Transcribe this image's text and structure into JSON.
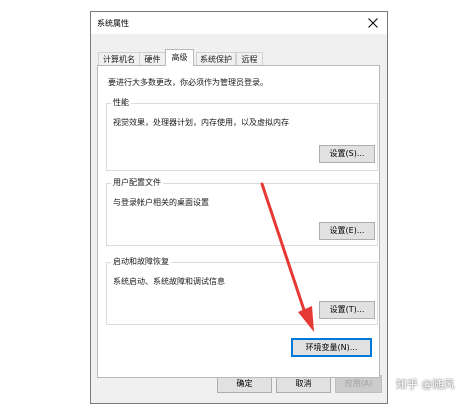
{
  "window": {
    "title": "系统属性"
  },
  "tabs": [
    {
      "label": "计算机名"
    },
    {
      "label": "硬件"
    },
    {
      "label": "高级"
    },
    {
      "label": "系统保护"
    },
    {
      "label": "远程"
    }
  ],
  "active_tab": "高级",
  "admin_note": "要进行大多数更改，你必须作为管理员登录。",
  "performance": {
    "title": "性能",
    "description": "视觉效果，处理器计划，内存使用，以及虚拟内存",
    "button": "设置(S)..."
  },
  "user_profiles": {
    "title": "用户配置文件",
    "description": "与登录帐户相关的桌面设置",
    "button": "设置(E)..."
  },
  "startup_recovery": {
    "title": "启动和故障恢复",
    "description": "系统启动、系统故障和调试信息",
    "button": "设置(T)..."
  },
  "env_button": "环境变量(N)...",
  "footer": {
    "ok": "确定",
    "cancel": "取消",
    "apply": "应用(A)"
  },
  "annotation": {
    "arrow_color": "#e53935"
  },
  "watermark": "知乎 @随风"
}
